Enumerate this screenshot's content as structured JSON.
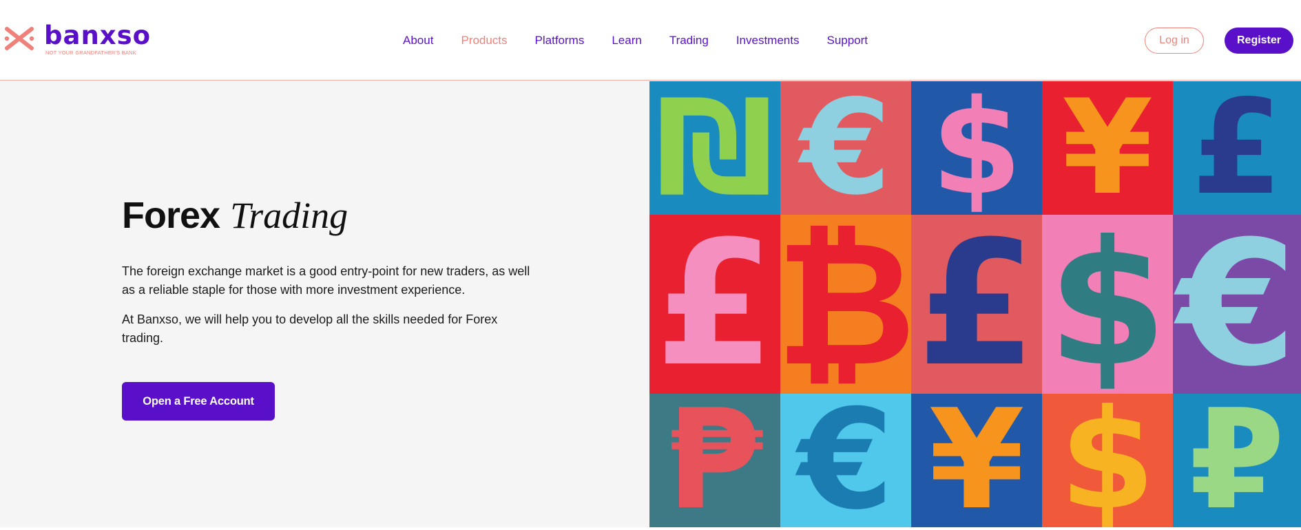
{
  "brand": {
    "name": "banxso",
    "tagline": "NOT YOUR GRANDFATHER'S BANK",
    "primary_color": "#5a10c8",
    "accent_color": "#f0817a"
  },
  "nav": {
    "items": [
      {
        "label": "About"
      },
      {
        "label": "Products",
        "active": true
      },
      {
        "label": "Platforms"
      },
      {
        "label": "Learn"
      },
      {
        "label": "Trading"
      },
      {
        "label": "Investments"
      },
      {
        "label": "Support"
      }
    ]
  },
  "auth": {
    "login_label": "Log in",
    "register_label": "Register"
  },
  "hero": {
    "title_bold": "Forex",
    "title_italic": "Trading",
    "paragraph_1": "The foreign exchange market is a good entry-point for new traders, as well as a reliable staple for those with more investment experience.",
    "paragraph_2": "At Banxso, we will help you to develop all the skills needed for Forex trading.",
    "cta_label": "Open a Free Account"
  },
  "currency_grid": [
    {
      "symbol": "₪",
      "bg": "#1a8bbf",
      "fg": "#8fd14f",
      "name": "shekel"
    },
    {
      "symbol": "€",
      "bg": "#e05a5f",
      "fg": "#8fd0e0",
      "name": "euro"
    },
    {
      "symbol": "$",
      "bg": "#2158a8",
      "fg": "#f27fb5",
      "name": "dollar"
    },
    {
      "symbol": "¥",
      "bg": "#e8202f",
      "fg": "#f7941e",
      "name": "yen"
    },
    {
      "symbol": "£",
      "bg": "#1a8bbf",
      "fg": "#2a3a8c",
      "name": "pound"
    },
    {
      "symbol": "£",
      "bg": "#e8202f",
      "fg": "#f48fbf",
      "name": "pound"
    },
    {
      "symbol": "₿",
      "bg": "#f57f20",
      "fg": "#e8202f",
      "name": "bitcoin"
    },
    {
      "symbol": "£",
      "bg": "#e05a5f",
      "fg": "#2a3a8c",
      "name": "pound"
    },
    {
      "symbol": "$",
      "bg": "#f27fb5",
      "fg": "#2f7c82",
      "name": "dollar"
    },
    {
      "symbol": "€",
      "bg": "#7b4aa6",
      "fg": "#8fd0e0",
      "name": "euro"
    },
    {
      "symbol": "₱",
      "bg": "#3d7a86",
      "fg": "#e8525a",
      "name": "peso"
    },
    {
      "symbol": "€",
      "bg": "#4fc8ec",
      "fg": "#1a7cb0",
      "name": "euro"
    },
    {
      "symbol": "¥",
      "bg": "#2158a8",
      "fg": "#f7941e",
      "name": "yen"
    },
    {
      "symbol": "$",
      "bg": "#f05a3a",
      "fg": "#f7b322",
      "name": "dollar"
    },
    {
      "symbol": "₽",
      "bg": "#1a8bbf",
      "fg": "#9ad886",
      "name": "ruble"
    }
  ]
}
